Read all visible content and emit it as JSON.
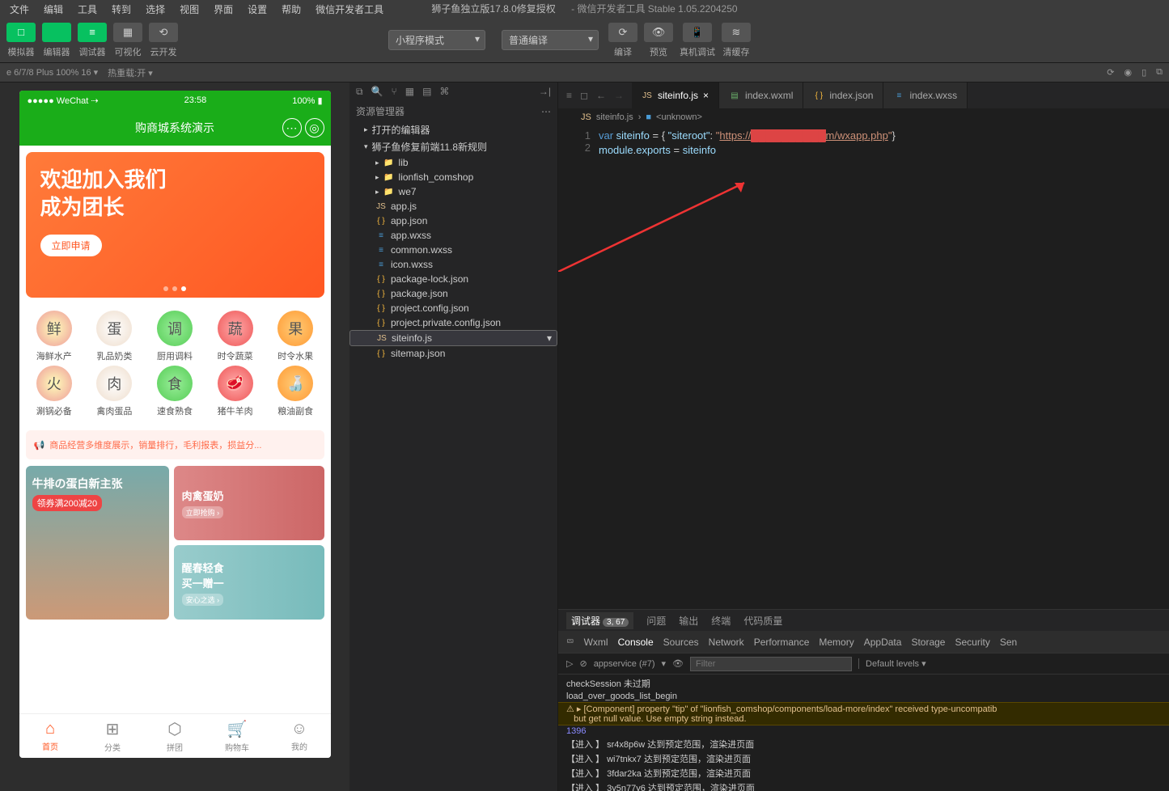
{
  "menubar": [
    "文件",
    "编辑",
    "工具",
    "转到",
    "选择",
    "视图",
    "界面",
    "设置",
    "帮助",
    "微信开发者工具"
  ],
  "title": {
    "project": "狮子鱼独立版17.8.0修复授权",
    "app": " - 微信开发者工具 Stable 1.05.2204250"
  },
  "toolbar": {
    "groups": [
      {
        "icon": "□",
        "label": "模拟器",
        "cls": "green"
      },
      {
        "icon": "</>",
        "label": "编辑器",
        "cls": "green"
      },
      {
        "icon": "≡",
        "label": "调试器",
        "cls": "green"
      },
      {
        "icon": "▦",
        "label": "可视化",
        "cls": "grey"
      },
      {
        "icon": "⟲",
        "label": "云开发",
        "cls": "grey"
      }
    ],
    "mode": "小程序模式",
    "compile": "普通编译",
    "right": [
      {
        "icon": "⟳",
        "label": "编译"
      },
      {
        "icon": "👁",
        "label": "预览"
      },
      {
        "icon": "📱",
        "label": "真机调试"
      },
      {
        "icon": "≋",
        "label": "清缓存"
      }
    ]
  },
  "simbar": {
    "device": "e 6/7/8 Plus 100% 16 ▾",
    "hot": "热重载:开 ▾"
  },
  "phone": {
    "status": {
      "l": "●●●●● WeChat ⇢",
      "c": "23:58",
      "r": "100% ▮"
    },
    "nav": "购商城系统演示",
    "banner": {
      "l1": "欢迎加入我们",
      "l2": "成为团长",
      "btn": "立即申请"
    },
    "cats": [
      "海鲜水产",
      "乳品奶类",
      "厨用调料",
      "时令蔬菜",
      "时令水果",
      "涮锅必备",
      "禽肉蛋品",
      "速食熟食",
      "猪牛羊肉",
      "粮油副食"
    ],
    "cat_em": [
      "鲜",
      "蛋",
      "调",
      "蔬",
      "果",
      "火",
      "肉",
      "食",
      "🥩",
      "🍶"
    ],
    "notice": "商品经营多维度展示，销量排行，毛利报表，损益分...",
    "promoL": {
      "t": "牛排の蛋白新主张",
      "s": "领券满200减20"
    },
    "promoR1": "肉禽蛋奶",
    "promoR1b": "立即抢购 ›",
    "promoR2": {
      "t": "醒春轻食",
      "s": "买一赠一",
      "b": "安心之选 ›"
    },
    "tabs": [
      "首页",
      "分类",
      "拼团",
      "购物车",
      "我的"
    ],
    "tab_ic": [
      "⌂",
      "⊞",
      "⬡",
      "🛒",
      "☺"
    ]
  },
  "explorer": {
    "title": "资源管理器",
    "s1": "打开的编辑器",
    "project": "狮子鱼修复前端11.8新规则",
    "folders": [
      "lib",
      "lionfish_comshop",
      "we7"
    ],
    "files": [
      {
        "n": "app.js",
        "t": "fjs"
      },
      {
        "n": "app.json",
        "t": "fjson"
      },
      {
        "n": "app.wxss",
        "t": "fwxss"
      },
      {
        "n": "common.wxss",
        "t": "fwxss"
      },
      {
        "n": "icon.wxss",
        "t": "fwxss"
      },
      {
        "n": "package-lock.json",
        "t": "fjson"
      },
      {
        "n": "package.json",
        "t": "fjson"
      },
      {
        "n": "project.config.json",
        "t": "fjson"
      },
      {
        "n": "project.private.config.json",
        "t": "fjson"
      },
      {
        "n": "siteinfo.js",
        "t": "fjs",
        "sel": true
      },
      {
        "n": "sitemap.json",
        "t": "fjson"
      }
    ]
  },
  "tabs": [
    {
      "n": "siteinfo.js",
      "ic": "JS",
      "active": true,
      "close": "×"
    },
    {
      "n": "index.wxml",
      "ic": "▤"
    },
    {
      "n": "index.json",
      "ic": "{ }"
    },
    {
      "n": "index.wxss",
      "ic": "≡"
    }
  ],
  "crumb": {
    "a": "siteinfo.js",
    "b": "<unknown>"
  },
  "code": {
    "l1": {
      "var": "var ",
      "id": "siteinfo",
      "eq": " = { ",
      "key": "\"siteroot\"",
      "col": ": ",
      "q1": "\"",
      "url": "https://",
      "redact": "██████████",
      "url2": "m/wxapp.php",
      "q2": "\"",
      "end": "}"
    },
    "l2": {
      "mod": "module",
      "dot": ".",
      "exp": "exports",
      "eq": " = ",
      "id": "siteinfo"
    }
  },
  "debugger": {
    "top": [
      "调试器",
      "问题",
      "输出",
      "终端",
      "代码质量"
    ],
    "topbadge": "3, 67",
    "dev": [
      "Wxml",
      "Console",
      "Sources",
      "Network",
      "Performance",
      "Memory",
      "AppData",
      "Storage",
      "Security",
      "Sen"
    ],
    "ctx": "appservice (#7)",
    "filter_ph": "Filter",
    "levels": "Default levels ▾",
    "logs": [
      {
        "t": "",
        "m": "checkSession 未过期"
      },
      {
        "t": "",
        "m": "load_over_goods_list_begin"
      },
      {
        "t": "warn",
        "m": "▸ [Component] property \"tip\" of \"lionfish_comshop/components/load-more/index\" received type-uncompatib\n  <String> but get null value. Use empty string instead."
      },
      {
        "t": "num",
        "m": "1396"
      },
      {
        "t": "",
        "m": "【进入 】 sr4x8p6w 达到预定范围，渲染进页面"
      },
      {
        "t": "",
        "m": "【进入 】 wi7tnkx7 达到预定范围，渲染进页面"
      },
      {
        "t": "",
        "m": "【进入 】 3fdar2ka 达到预定范围，渲染进页面"
      },
      {
        "t": "",
        "m": "【进入 】 3y5n77y6 达到预定范围，渲染进页面"
      }
    ]
  }
}
